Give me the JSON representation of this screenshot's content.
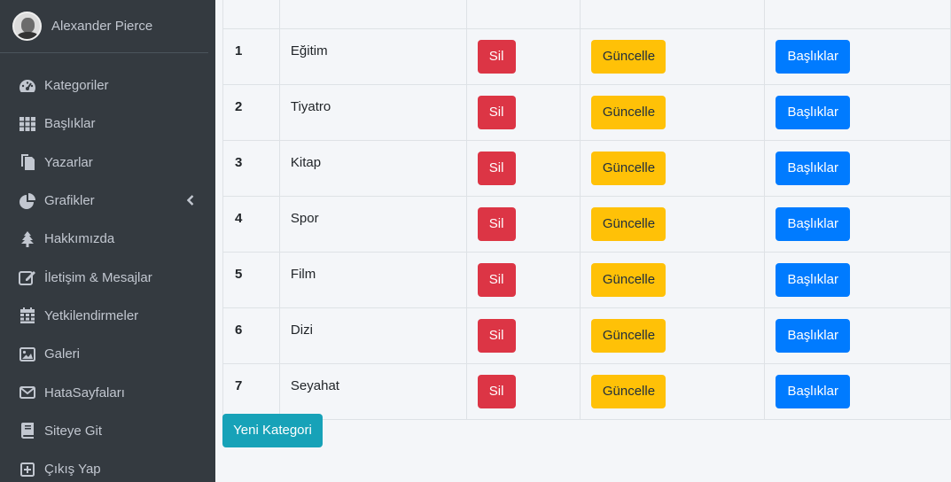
{
  "user": {
    "name": "Alexander Pierce"
  },
  "sidebar": {
    "items": [
      {
        "label": "Kategoriler",
        "icon": "tachometer-icon"
      },
      {
        "label": "Başlıklar",
        "icon": "grid-icon"
      },
      {
        "label": "Yazarlar",
        "icon": "copy-icon"
      },
      {
        "label": "Grafikler",
        "icon": "pie-chart-icon"
      },
      {
        "label": "Hakkımızda",
        "icon": "tree-icon"
      },
      {
        "label": "İletişim & Mesajlar",
        "icon": "edit-icon"
      },
      {
        "label": "Yetkilendirmeler",
        "icon": "calendar-icon"
      },
      {
        "label": "Galeri",
        "icon": "image-icon"
      },
      {
        "label": "HataSayfaları",
        "icon": "envelope-icon"
      },
      {
        "label": "Siteye Git",
        "icon": "book-icon"
      },
      {
        "label": "Çıkış Yap",
        "icon": "plus-square-icon"
      }
    ]
  },
  "table": {
    "rows": [
      {
        "id": "1",
        "name": "Eğitim"
      },
      {
        "id": "2",
        "name": "Tiyatro"
      },
      {
        "id": "3",
        "name": "Kitap"
      },
      {
        "id": "4",
        "name": "Spor"
      },
      {
        "id": "5",
        "name": "Film"
      },
      {
        "id": "6",
        "name": "Dizi"
      },
      {
        "id": "7",
        "name": "Seyahat"
      }
    ],
    "delete_label": "Sil",
    "update_label": "Güncelle",
    "headings_label": "Başlıklar"
  },
  "new_category_label": "Yeni Kategori",
  "colors": {
    "sidebar_bg": "#343a40",
    "danger": "#dc3545",
    "warning": "#ffc107",
    "primary": "#007bff",
    "info": "#17a2b8"
  }
}
